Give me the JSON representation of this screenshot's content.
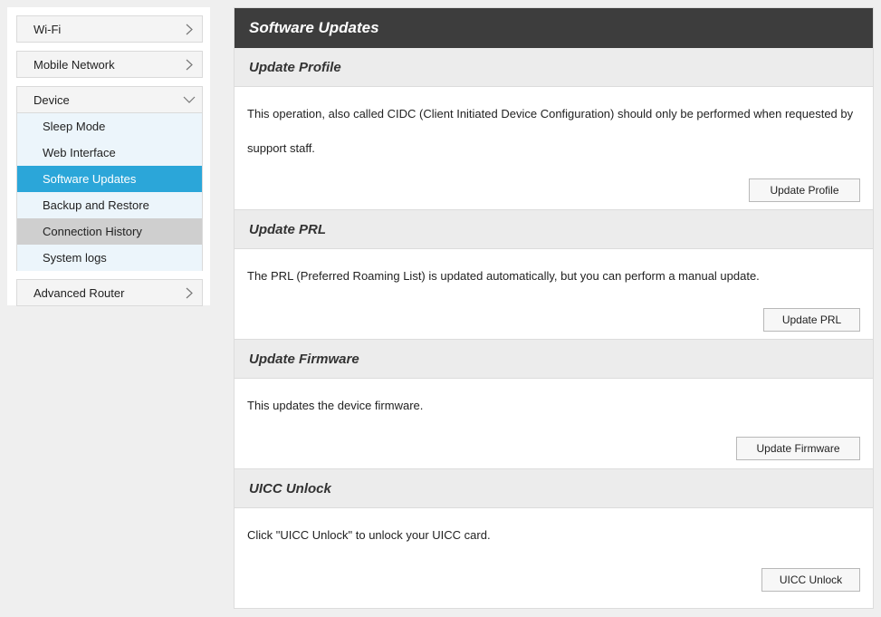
{
  "sidebar": {
    "groups": [
      {
        "label": "Wi-Fi",
        "chevron": "chevron-right-icon"
      },
      {
        "label": "Mobile Network",
        "chevron": "chevron-right-icon"
      },
      {
        "label": "Device",
        "chevron": "chevron-down-icon",
        "items": [
          {
            "label": "Sleep Mode"
          },
          {
            "label": "Web Interface"
          },
          {
            "label": "Software Updates",
            "state": "active"
          },
          {
            "label": "Backup and Restore"
          },
          {
            "label": "Connection History",
            "state": "hover"
          },
          {
            "label": "System logs"
          }
        ]
      },
      {
        "label": "Advanced Router",
        "chevron": "chevron-right-icon"
      }
    ]
  },
  "main": {
    "title": "Software Updates",
    "sections": [
      {
        "heading": "Update Profile",
        "description": "This operation, also called CIDC (Client Initiated Device Configuration) should only be performed when requested by support staff.",
        "button": "Update Profile"
      },
      {
        "heading": "Update PRL",
        "description": "The PRL (Preferred Roaming List) is updated automatically, but you can perform a manual update.",
        "button": "Update PRL"
      },
      {
        "heading": "Update Firmware",
        "description": "This updates the device firmware.",
        "button": "Update Firmware"
      },
      {
        "heading": "UICC Unlock",
        "description": "Click \"UICC Unlock\" to unlock your UICC card.",
        "button": "UICC Unlock"
      }
    ]
  },
  "colors": {
    "active": "#2ba6d9",
    "hover": "#cfcfcf",
    "title_bar": "#3d3d3d",
    "section_head": "#ececec"
  }
}
